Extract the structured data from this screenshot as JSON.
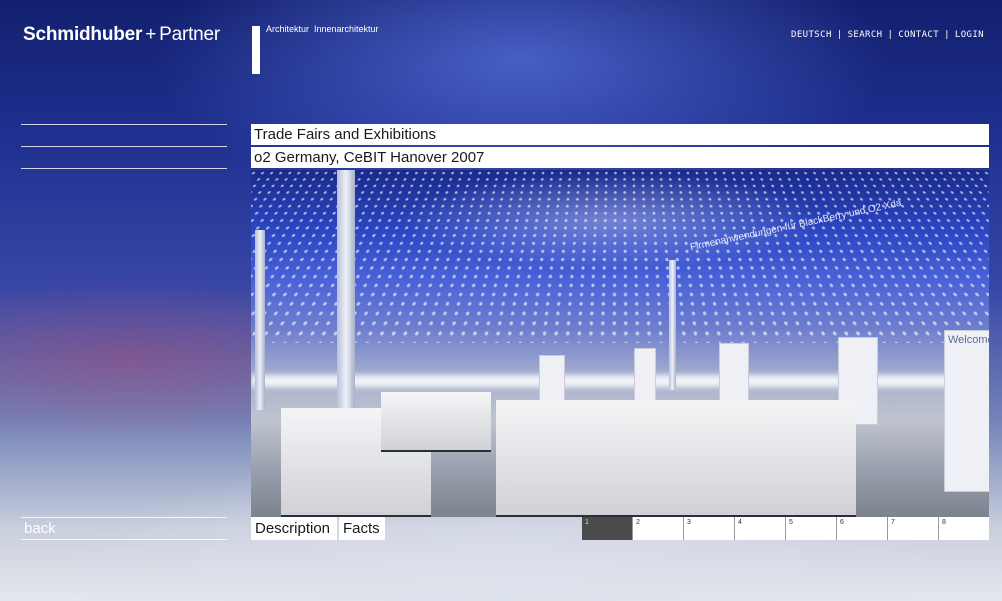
{
  "header": {
    "brand_bold": "Schmidhuber",
    "brand_plus": "+",
    "brand_rest": "Partner",
    "subtitle_1": "Architektur",
    "subtitle_2": "Innenarchitektur"
  },
  "topnav": {
    "items": [
      "DEUTSCH",
      "SEARCH",
      "CONTACT",
      "LOGIN"
    ],
    "separator": "|"
  },
  "sidebar": {
    "back_label": "back"
  },
  "main": {
    "category": "Trade Fairs and Exhibitions",
    "project_title": "o2 Germany, CeBIT Hanover 2007",
    "photo_texts": {
      "welcome": "Welcome",
      "sign": "Firmenanwendungen für BlackBerry und O2 Xda"
    },
    "tabs": [
      "Description",
      "Facts"
    ],
    "pages": [
      "1",
      "2",
      "3",
      "4",
      "5",
      "6",
      "7",
      "8"
    ],
    "active_page": "1"
  }
}
